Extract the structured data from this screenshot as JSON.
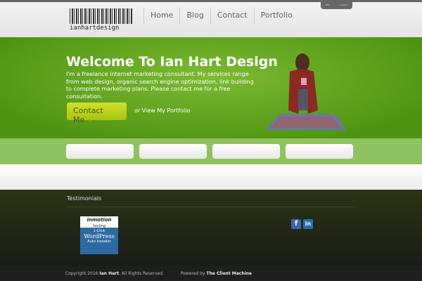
{
  "header": {
    "logo_text": "ianhartdesign",
    "nav": [
      "Home",
      "Blog",
      "Contact",
      "Portfolio"
    ],
    "mini_links": [
      "SEO",
      "Contact"
    ]
  },
  "hero": {
    "title": "Welcome To Ian Hart Design",
    "body": "I'm a freelance internet marketing consultant. My services range from web design, organic search engine optimization, link building to complete marketing plans. Please contact me for a free consultation.",
    "cta": "Contact Me",
    "portfolio_link": "or View My Portfolio"
  },
  "footer": {
    "testimonials": "Testimonials",
    "ad": {
      "brand": "inmotion",
      "sub": "hosting",
      "l1": "1-Click",
      "l2": "WordPress",
      "l3": "Auto Installer"
    },
    "social": [
      "f",
      "in"
    ],
    "copyright_pre": "Copyright 2016",
    "owner": "Ian Hart",
    "copyright_post": ". All Rights Reserved.",
    "powered": "Powered by",
    "powered_name": "The Client Machine"
  },
  "colors": {
    "green": "#5fa51c",
    "band": "#8fc35f",
    "cta": "#bed322"
  }
}
